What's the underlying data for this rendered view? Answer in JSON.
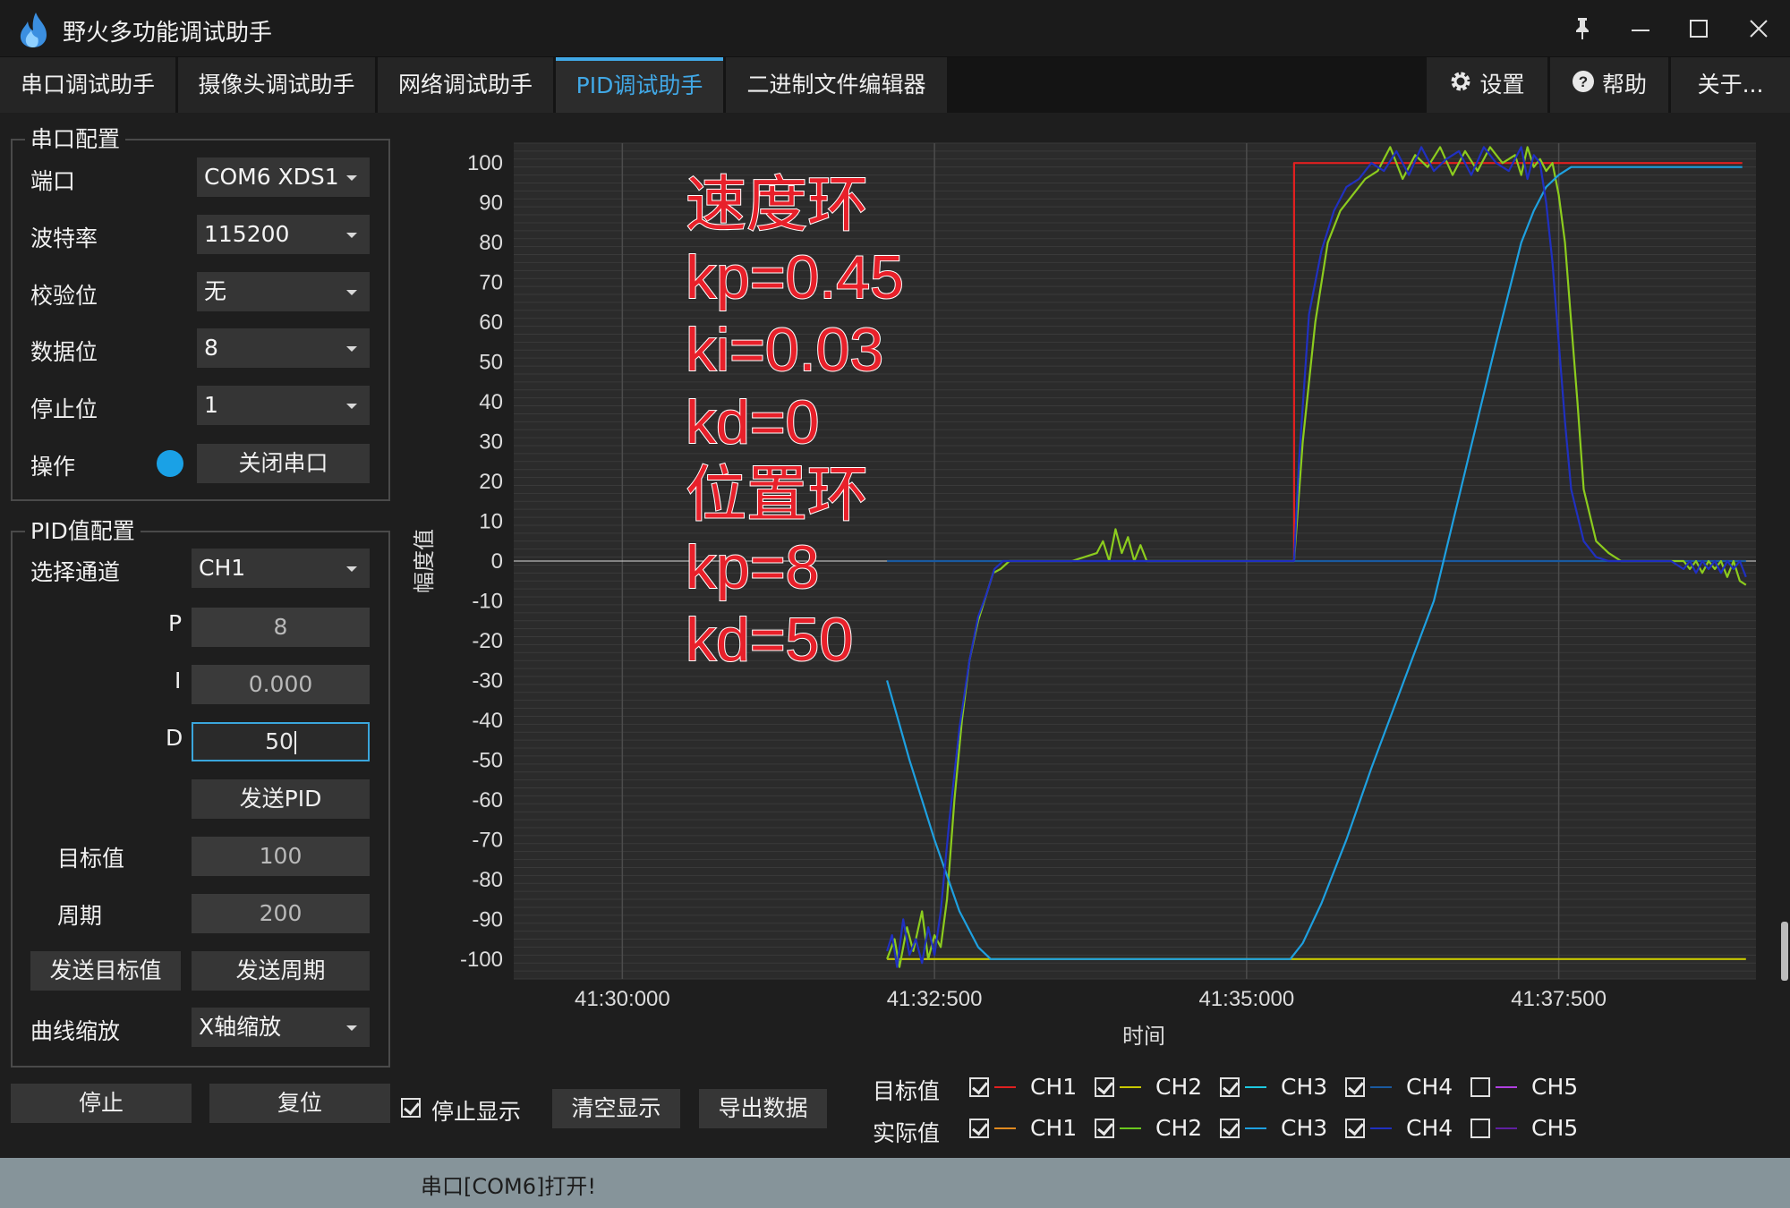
{
  "window": {
    "title": "野火多功能调试助手",
    "pin_icon": "pin-icon",
    "minimize_icon": "minimize-icon",
    "maximize_icon": "maximize-icon",
    "close_icon": "close-icon"
  },
  "tabs": [
    {
      "label": "串口调试助手"
    },
    {
      "label": "摄像头调试助手"
    },
    {
      "label": "网络调试助手"
    },
    {
      "label": "PID调试助手",
      "active": true
    },
    {
      "label": "二进制文件编辑器"
    }
  ],
  "right_tabs": {
    "settings": "设置",
    "help": "帮助",
    "about": "关于..."
  },
  "serial_config": {
    "title": "串口配置",
    "port_label": "端口",
    "port_value": "COM6 XDS1",
    "baud_label": "波特率",
    "baud_value": "115200",
    "parity_label": "校验位",
    "parity_value": "无",
    "databits_label": "数据位",
    "databits_value": "8",
    "stopbits_label": "停止位",
    "stopbits_value": "1",
    "action_label": "操作",
    "close_button": "关闭串口"
  },
  "pid_config": {
    "title": "PID值配置",
    "channel_label": "选择通道",
    "channel_value": "CH1",
    "p_label": "P",
    "p_value": "8",
    "i_label": "I",
    "i_value": "0.000",
    "d_label": "D",
    "d_value": "50",
    "send_pid_button": "发送PID",
    "target_label": "目标值",
    "target_value": "100",
    "period_label": "周期",
    "period_value": "200",
    "send_target_button": "发送目标值",
    "send_period_button": "发送周期",
    "zoom_label": "曲线缩放",
    "zoom_value": "X轴缩放"
  },
  "controls": {
    "stop_button": "停止",
    "reset_button": "复位",
    "stop_display_label": "停止显示",
    "clear_button": "清空显示",
    "export_button": "导出数据"
  },
  "legend": {
    "target_label": "目标值",
    "actual_label": "实际值",
    "target_channels": [
      {
        "name": "CH1",
        "checked": true,
        "color": "#e02020"
      },
      {
        "name": "CH2",
        "checked": true,
        "color": "#c8c800"
      },
      {
        "name": "CH3",
        "checked": true,
        "color": "#1ec8e0"
      },
      {
        "name": "CH4",
        "checked": true,
        "color": "#1a5aa0"
      },
      {
        "name": "CH5",
        "checked": false,
        "color": "#b040e0"
      }
    ],
    "actual_channels": [
      {
        "name": "CH1",
        "checked": true,
        "color": "#e08a20"
      },
      {
        "name": "CH2",
        "checked": true,
        "color": "#6ac81e"
      },
      {
        "name": "CH3",
        "checked": true,
        "color": "#1ea0e0"
      },
      {
        "name": "CH4",
        "checked": true,
        "color": "#2030c0"
      },
      {
        "name": "CH5",
        "checked": false,
        "color": "#6020a0"
      }
    ]
  },
  "annotation": {
    "lines": [
      "速度环",
      "kp=0.45",
      "ki=0.03",
      "kd=0",
      "位置环",
      "kp=8",
      "kd=50"
    ],
    "color": "#e8202a"
  },
  "status": {
    "text": "串口[COM6]打开!"
  },
  "chart_data": {
    "type": "line",
    "xlabel": "时间",
    "ylabel": "幅度值",
    "x_ticks": [
      "41:30:000",
      "41:32:500",
      "41:35:000",
      "41:37:500"
    ],
    "x_tick_seconds": [
      0,
      2.5,
      5.0,
      7.5
    ],
    "xlim_seconds": [
      -0.87,
      9.08
    ],
    "ylim": [
      -105,
      105
    ],
    "y_ticks": [
      100,
      90,
      80,
      70,
      60,
      50,
      40,
      30,
      20,
      10,
      0,
      -10,
      -20,
      -30,
      -40,
      -50,
      -60,
      -70,
      -80,
      -90,
      -100
    ],
    "grid": true,
    "series": [
      {
        "name": "目标值 CH1",
        "color": "#e02020",
        "x": [
          5.38,
          5.38,
          8.97
        ],
        "y": [
          0,
          100,
          100
        ]
      },
      {
        "name": "目标值 CH2",
        "color": "#c8c800",
        "x": [
          2.12,
          9.0
        ],
        "y": [
          -100,
          -100
        ]
      },
      {
        "name": "目标值 CH4",
        "color": "#1a5aa0",
        "x": [
          2.12,
          9.0
        ],
        "y": [
          0,
          0
        ]
      },
      {
        "name": "实际值 CH2",
        "color": "#8ccc1e",
        "x": [
          2.12,
          2.18,
          2.22,
          2.28,
          2.33,
          2.4,
          2.45,
          2.5,
          2.55,
          2.6,
          2.66,
          2.72,
          2.78,
          2.85,
          2.92,
          2.97,
          3.03,
          3.1,
          3.2,
          3.6,
          3.8,
          3.85,
          3.9,
          3.95,
          4.0,
          4.05,
          4.1,
          4.15,
          4.2,
          4.3,
          5.0,
          5.38,
          5.45,
          5.55,
          5.65,
          5.75,
          5.85,
          5.95,
          6.05,
          6.15,
          6.25,
          6.35,
          6.45,
          6.55,
          6.65,
          6.75,
          6.85,
          6.95,
          7.05,
          7.15,
          7.2,
          7.25,
          7.3,
          7.35,
          7.4,
          7.45,
          7.5,
          7.55,
          7.6,
          7.65,
          7.7,
          7.8,
          7.9,
          8.0,
          8.1,
          8.2,
          8.3,
          8.4,
          8.5,
          8.55,
          8.6,
          8.65,
          8.7,
          8.75,
          8.8,
          8.85,
          8.9,
          8.95,
          9.0
        ],
        "y": [
          -100,
          -95,
          -102,
          -92,
          -98,
          -88,
          -100,
          -94,
          -97,
          -85,
          -60,
          -40,
          -25,
          -15,
          -8,
          -3,
          -2,
          0,
          0,
          0,
          2,
          5,
          0,
          8,
          2,
          6,
          0,
          4,
          0,
          0,
          0,
          0,
          30,
          60,
          80,
          88,
          92,
          96,
          98,
          104,
          96,
          102,
          99,
          104,
          97,
          103,
          98,
          104,
          100,
          102,
          97,
          104,
          99,
          101,
          98,
          100,
          92,
          80,
          60,
          40,
          18,
          5,
          2,
          0,
          0,
          0,
          0,
          0,
          0,
          -2,
          0,
          -3,
          0,
          -2,
          0,
          -4,
          0,
          -5,
          -6
        ]
      },
      {
        "name": "实际值 CH3",
        "color": "#1ea0e0",
        "x": [
          2.12,
          2.3,
          2.5,
          2.7,
          2.85,
          2.95,
          3.1,
          3.5,
          4.5,
          5.35,
          5.45,
          5.6,
          5.8,
          6.0,
          6.5,
          7.0,
          7.2,
          7.3,
          7.4,
          7.5,
          7.6,
          8.0,
          8.5,
          8.97
        ],
        "y": [
          -30,
          -50,
          -70,
          -88,
          -97,
          -100,
          -100,
          -100,
          -100,
          -100,
          -96,
          -86,
          -70,
          -52,
          -10,
          55,
          80,
          88,
          94,
          97,
          99,
          99,
          99,
          99
        ]
      },
      {
        "name": "实际值 CH4",
        "color": "#2030c0",
        "x": [
          2.12,
          2.16,
          2.2,
          2.25,
          2.3,
          2.35,
          2.4,
          2.45,
          2.5,
          2.55,
          2.62,
          2.7,
          2.78,
          2.85,
          2.92,
          2.98,
          3.05,
          3.15,
          3.6,
          3.85,
          4.1,
          4.3,
          5.38,
          5.42,
          5.5,
          5.6,
          5.7,
          5.8,
          5.9,
          6.0,
          6.1,
          6.2,
          6.3,
          6.4,
          6.5,
          6.6,
          6.7,
          6.8,
          6.9,
          7.0,
          7.1,
          7.2,
          7.25,
          7.3,
          7.35,
          7.4,
          7.45,
          7.5,
          7.55,
          7.6,
          7.7,
          7.8,
          7.9,
          8.0,
          8.4,
          8.5,
          8.55,
          8.6,
          8.65,
          8.7,
          8.75,
          8.8,
          8.85,
          8.9,
          8.95,
          9.0
        ],
        "y": [
          -98,
          -94,
          -102,
          -90,
          -99,
          -95,
          -101,
          -92,
          -99,
          -88,
          -65,
          -42,
          -25,
          -14,
          -8,
          -2,
          0,
          0,
          0,
          0,
          0,
          0,
          0,
          25,
          62,
          78,
          88,
          94,
          96,
          100,
          98,
          103,
          97,
          104,
          98,
          101,
          103,
          97,
          104,
          100,
          98,
          104,
          96,
          102,
          100,
          90,
          75,
          55,
          35,
          18,
          5,
          1,
          0,
          0,
          0,
          -2,
          0,
          -3,
          0,
          -2,
          0,
          -3,
          0,
          -2,
          0,
          -4
        ]
      }
    ]
  }
}
